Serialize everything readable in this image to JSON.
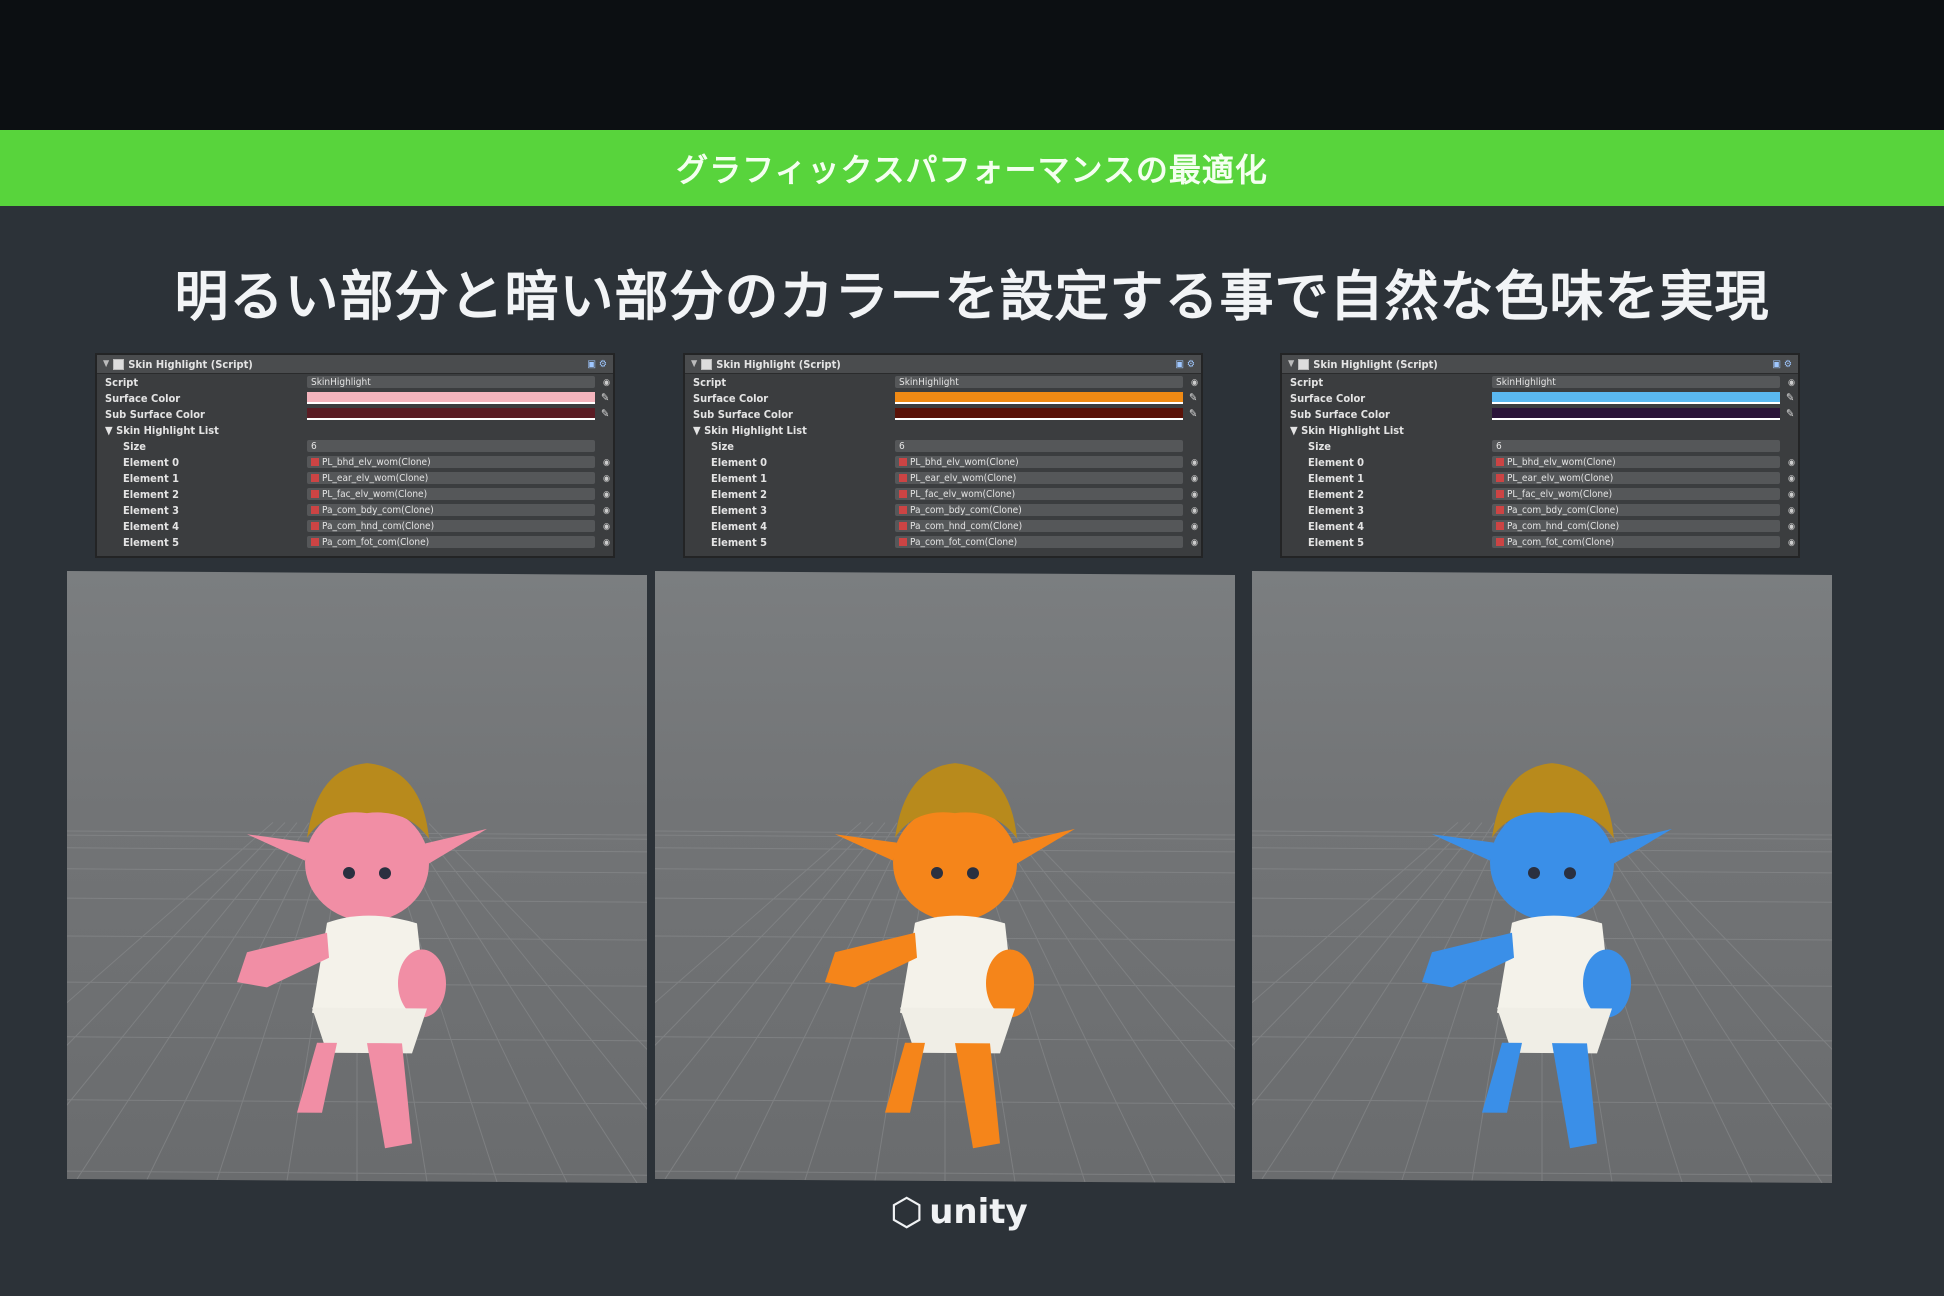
{
  "banner": {
    "text": "グラフィックスパフォーマンスの最適化"
  },
  "headline": {
    "text": "明るい部分と暗い部分のカラーを設定する事で自然な色味を実現"
  },
  "panels": [
    {
      "component_title": "Skin Highlight (Script)",
      "script_label": "Script",
      "script_value": "SkinHighlight",
      "surface_label": "Surface Color",
      "sub_surface_label": "Sub Surface Color",
      "list_label": "Skin Highlight List",
      "size_label": "Size",
      "size_value": "6",
      "surface_color": "#f4b4bd",
      "sub_surface_color": "#5a1c24",
      "skin_color": "#f18ea5",
      "elements": [
        {
          "label": "Element 0",
          "value": "PL_bhd_elv_wom(Clone)"
        },
        {
          "label": "Element 1",
          "value": "PL_ear_elv_wom(Clone)"
        },
        {
          "label": "Element 2",
          "value": "PL_fac_elv_wom(Clone)"
        },
        {
          "label": "Element 3",
          "value": "Pa_com_bdy_com(Clone)"
        },
        {
          "label": "Element 4",
          "value": "Pa_com_hnd_com(Clone)"
        },
        {
          "label": "Element 5",
          "value": "Pa_com_fot_com(Clone)"
        }
      ]
    },
    {
      "component_title": "Skin Highlight (Script)",
      "script_label": "Script",
      "script_value": "SkinHighlight",
      "surface_label": "Surface Color",
      "sub_surface_label": "Sub Surface Color",
      "list_label": "Skin Highlight List",
      "size_label": "Size",
      "size_value": "6",
      "surface_color": "#f08a14",
      "sub_surface_color": "#5a1208",
      "skin_color": "#f5851a",
      "elements": [
        {
          "label": "Element 0",
          "value": "PL_bhd_elv_wom(Clone)"
        },
        {
          "label": "Element 1",
          "value": "PL_ear_elv_wom(Clone)"
        },
        {
          "label": "Element 2",
          "value": "PL_fac_elv_wom(Clone)"
        },
        {
          "label": "Element 3",
          "value": "Pa_com_bdy_com(Clone)"
        },
        {
          "label": "Element 4",
          "value": "Pa_com_hnd_com(Clone)"
        },
        {
          "label": "Element 5",
          "value": "Pa_com_fot_com(Clone)"
        }
      ]
    },
    {
      "component_title": "Skin Highlight (Script)",
      "script_label": "Script",
      "script_value": "SkinHighlight",
      "surface_label": "Surface Color",
      "sub_surface_label": "Sub Surface Color",
      "list_label": "Skin Highlight List",
      "size_label": "Size",
      "size_value": "6",
      "surface_color": "#5ab8f0",
      "sub_surface_color": "#2a1438",
      "skin_color": "#3a8fe8",
      "elements": [
        {
          "label": "Element 0",
          "value": "PL_bhd_elv_wom(Clone)"
        },
        {
          "label": "Element 1",
          "value": "PL_ear_elv_wom(Clone)"
        },
        {
          "label": "Element 2",
          "value": "PL_fac_elv_wom(Clone)"
        },
        {
          "label": "Element 3",
          "value": "Pa_com_bdy_com(Clone)"
        },
        {
          "label": "Element 4",
          "value": "Pa_com_hnd_com(Clone)"
        },
        {
          "label": "Element 5",
          "value": "Pa_com_fot_com(Clone)"
        }
      ]
    }
  ],
  "logo": {
    "text": "unity",
    "icon": "unity-cube-icon"
  },
  "colors": {
    "banner_green": "#58d43c",
    "background": "#2c3238"
  }
}
